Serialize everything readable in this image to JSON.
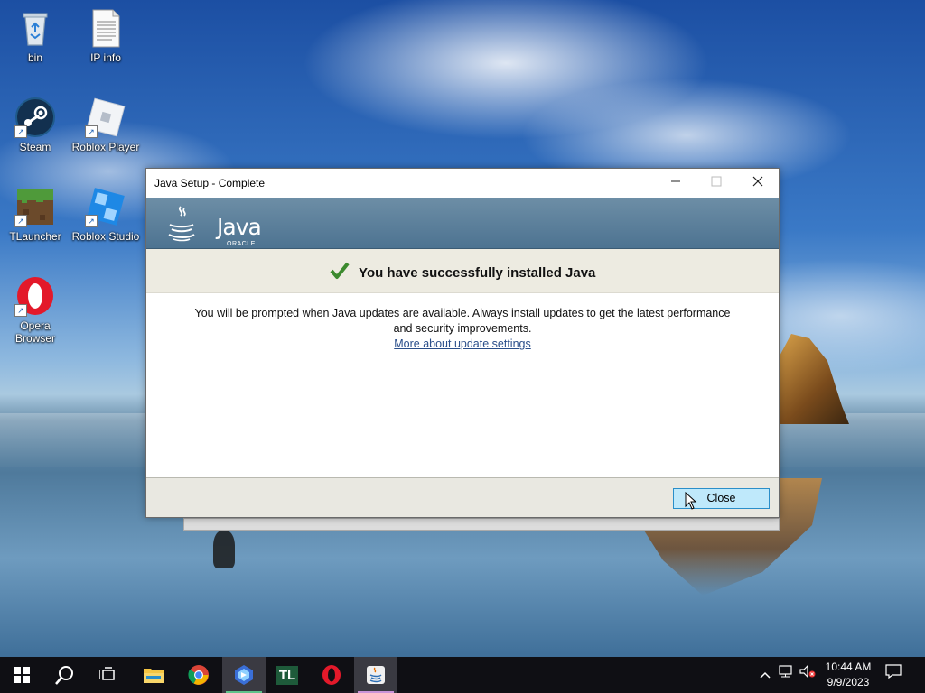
{
  "desktop": {
    "icons": [
      {
        "label": "bin",
        "icon": "recycle-bin-icon"
      },
      {
        "label": "IP info",
        "icon": "text-file-icon"
      },
      {
        "label": "Steam",
        "icon": "steam-icon"
      },
      {
        "label": "Roblox Player",
        "icon": "roblox-player-icon"
      },
      {
        "label": "TLauncher",
        "icon": "tlauncher-icon"
      },
      {
        "label": "Roblox Studio",
        "icon": "roblox-studio-icon"
      },
      {
        "label": "Opera Browser",
        "icon": "opera-icon"
      }
    ]
  },
  "window": {
    "title": "Java Setup - Complete",
    "banner": {
      "brand": "Java",
      "vendor": "ORACLE"
    },
    "success_message": "You have successfully installed Java",
    "body_line1": "You will be prompted when Java updates are available. Always install updates to get the latest performance",
    "body_line2": "and security improvements.",
    "link_text": "More about update settings",
    "close_button": "Close",
    "colors": {
      "accent": "#2a8ec9",
      "button_bg": "#bfe9fb",
      "success_check": "#3c8a2e"
    }
  },
  "taskbar": {
    "pinned": [
      {
        "name": "start-button",
        "icon": "windows-logo-icon"
      },
      {
        "name": "search-button",
        "icon": "search-icon"
      },
      {
        "name": "task-view-button",
        "icon": "task-view-icon"
      },
      {
        "name": "file-explorer",
        "icon": "folder-icon"
      },
      {
        "name": "chrome",
        "icon": "chrome-icon"
      },
      {
        "name": "bing-app",
        "icon": "bing-icon"
      },
      {
        "name": "tlauncher",
        "icon": "tlauncher-tb-icon",
        "label": "TL"
      },
      {
        "name": "opera",
        "icon": "opera-icon"
      },
      {
        "name": "java-setup",
        "icon": "java-icon"
      }
    ],
    "clock": {
      "time": "10:44 AM",
      "date": "9/9/2023"
    }
  }
}
